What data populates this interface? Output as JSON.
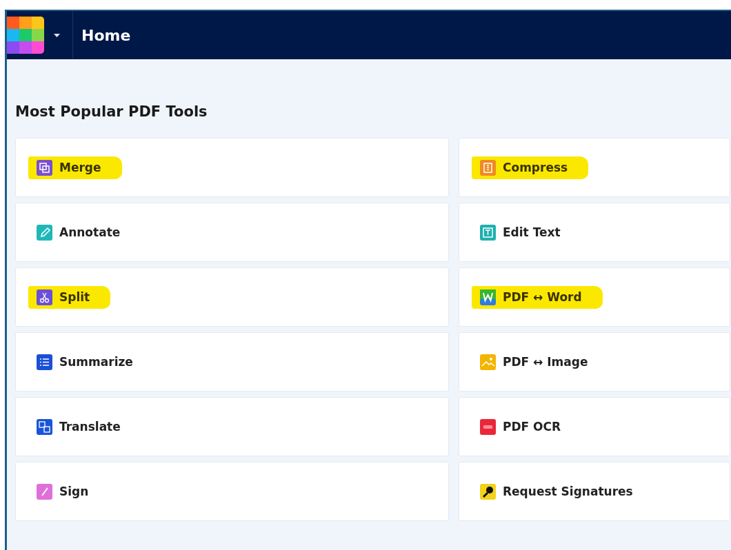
{
  "header": {
    "title": "Home"
  },
  "section": {
    "heading": "Most Popular PDF Tools"
  },
  "tools": [
    {
      "label": "Merge",
      "kind": "merge",
      "color": "#7a4fd0",
      "highlighted": true
    },
    {
      "label": "Compress",
      "kind": "compress",
      "color": "#f08a24",
      "highlighted": true
    },
    {
      "label": "Annotate",
      "kind": "annotate",
      "color": "#1fb8b8",
      "highlighted": false
    },
    {
      "label": "Edit Text",
      "kind": "edittext",
      "color": "#1fb0b0",
      "highlighted": false
    },
    {
      "label": "Split",
      "kind": "split",
      "color": "#6a4fd8",
      "highlighted": true
    },
    {
      "label": "PDF ↔ Word",
      "kind": "word",
      "color": "#2f7de1",
      "highlighted": true
    },
    {
      "label": "Summarize",
      "kind": "summarize",
      "color": "#1a4fd8",
      "highlighted": false
    },
    {
      "label": "PDF ↔ Image",
      "kind": "image",
      "color": "#f5b400",
      "highlighted": false
    },
    {
      "label": "Translate",
      "kind": "translate",
      "color": "#1a55d8",
      "highlighted": false
    },
    {
      "label": "PDF OCR",
      "kind": "ocr",
      "color": "#e8283a",
      "highlighted": false
    },
    {
      "label": "Sign",
      "kind": "sign",
      "color": "#e070d8",
      "highlighted": false
    },
    {
      "label": "Request Signatures",
      "kind": "request",
      "color": "#f2d21a",
      "highlighted": false
    }
  ]
}
